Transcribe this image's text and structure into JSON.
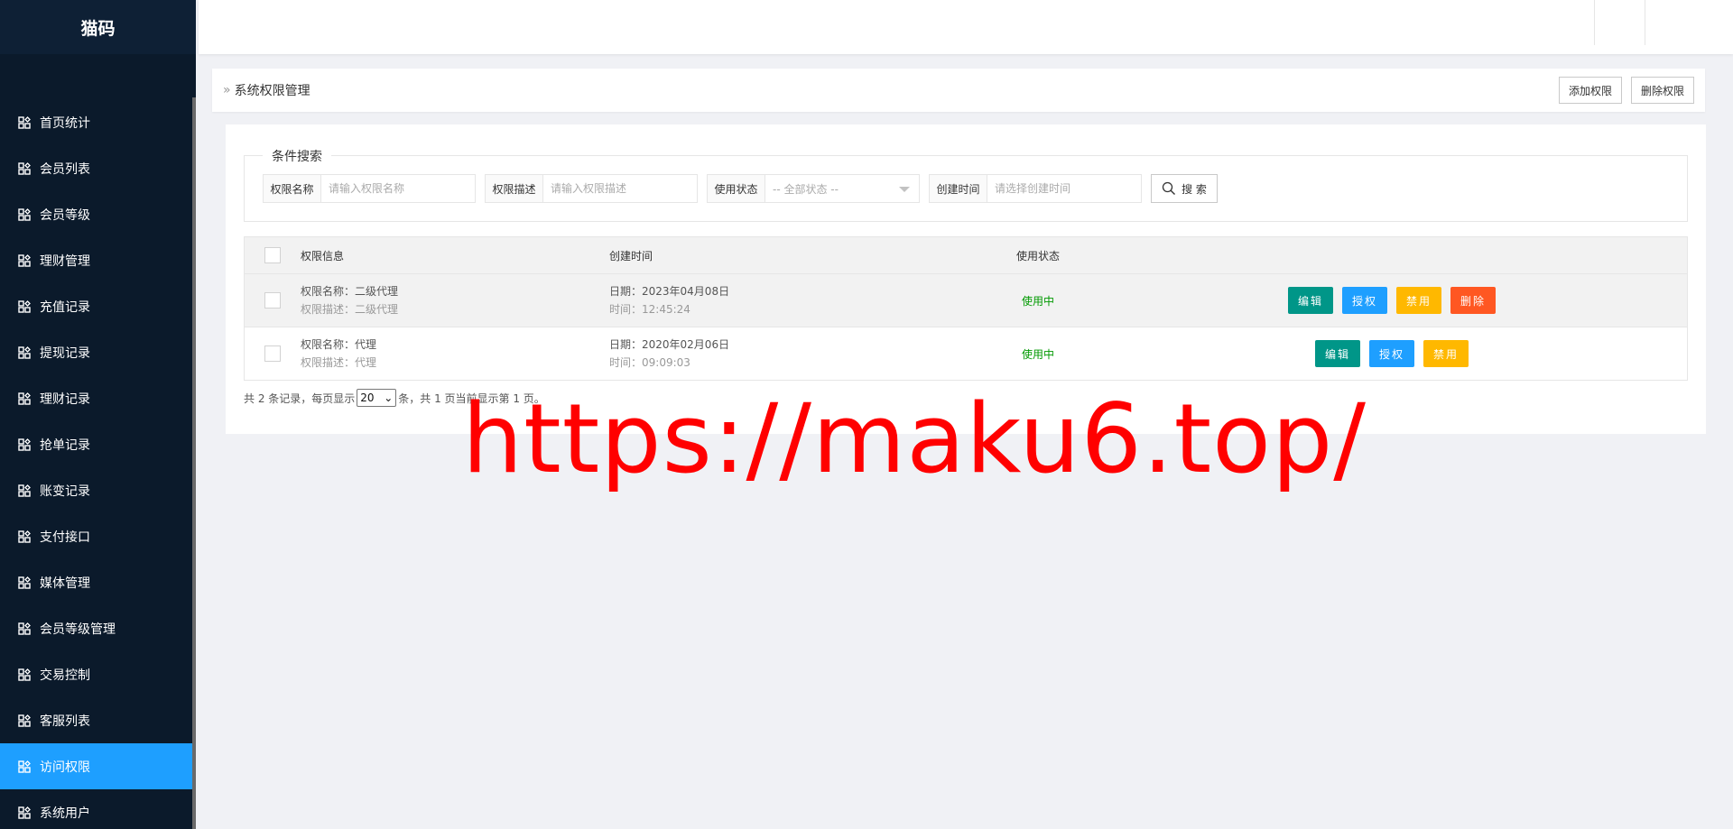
{
  "app": {
    "logo": "猫码"
  },
  "sidebar": {
    "items": [
      {
        "label": "首页统计",
        "icon": "grid-icon"
      },
      {
        "label": "会员列表",
        "icon": "grid-icon"
      },
      {
        "label": "会员等级",
        "icon": "grid-icon"
      },
      {
        "label": "理财管理",
        "icon": "grid-icon"
      },
      {
        "label": "充值记录",
        "icon": "grid-icon"
      },
      {
        "label": "提现记录",
        "icon": "grid-icon"
      },
      {
        "label": "理财记录",
        "icon": "grid-icon"
      },
      {
        "label": "抢单记录",
        "icon": "grid-icon"
      },
      {
        "label": "账变记录",
        "icon": "grid-icon"
      },
      {
        "label": "支付接口",
        "icon": "grid-icon"
      },
      {
        "label": "媒体管理",
        "icon": "grid-icon"
      },
      {
        "label": "会员等级管理",
        "icon": "grid-icon"
      },
      {
        "label": "交易控制",
        "icon": "grid-icon"
      },
      {
        "label": "客服列表",
        "icon": "grid-icon"
      },
      {
        "label": "访问权限",
        "icon": "grid-icon",
        "active": true
      },
      {
        "label": "系统用户",
        "icon": "grid-icon"
      }
    ]
  },
  "breadcrumb": {
    "chevron": "»",
    "title": "系统权限管理"
  },
  "toolbar": {
    "add_label": "添加权限",
    "delete_label": "删除权限"
  },
  "search": {
    "legend": "条件搜索",
    "name_label": "权限名称",
    "name_placeholder": "请输入权限名称",
    "desc_label": "权限描述",
    "desc_placeholder": "请输入权限描述",
    "status_label": "使用状态",
    "status_value": "-- 全部状态 --",
    "time_label": "创建时间",
    "time_placeholder": "请选择创建时间",
    "button_label": "搜 索"
  },
  "table": {
    "headers": {
      "info": "权限信息",
      "time": "创建时间",
      "status": "使用状态"
    },
    "rows": [
      {
        "name": "权限名称：二级代理",
        "desc": "权限描述：二级代理",
        "date": "日期：2023年04月08日",
        "time": "时间：12:45:24",
        "status": "使用中",
        "actions": {
          "edit": "编辑",
          "auth": "授权",
          "disable": "禁用",
          "delete": "删除"
        }
      },
      {
        "name": "权限名称：代理",
        "desc": "权限描述：代理",
        "date": "日期：2020年02月06日",
        "time": "时间：09:09:03",
        "status": "使用中",
        "actions": {
          "edit": "编辑",
          "auth": "授权",
          "disable": "禁用"
        }
      }
    ]
  },
  "pager": {
    "prefix": "共 2 条记录，每页显示",
    "page_size": "20",
    "suffix": "条，共 1 页当前显示第 1 页。"
  },
  "watermark": "https://maku6.top/",
  "colors": {
    "sidebar_bg": "#0b1a2b",
    "active": "#1e9fff",
    "edit": "#009688",
    "auth": "#1e9fff",
    "disable": "#ffb800",
    "delete": "#ff5722",
    "status_ok": "#009900",
    "watermark": "#ff0000"
  }
}
